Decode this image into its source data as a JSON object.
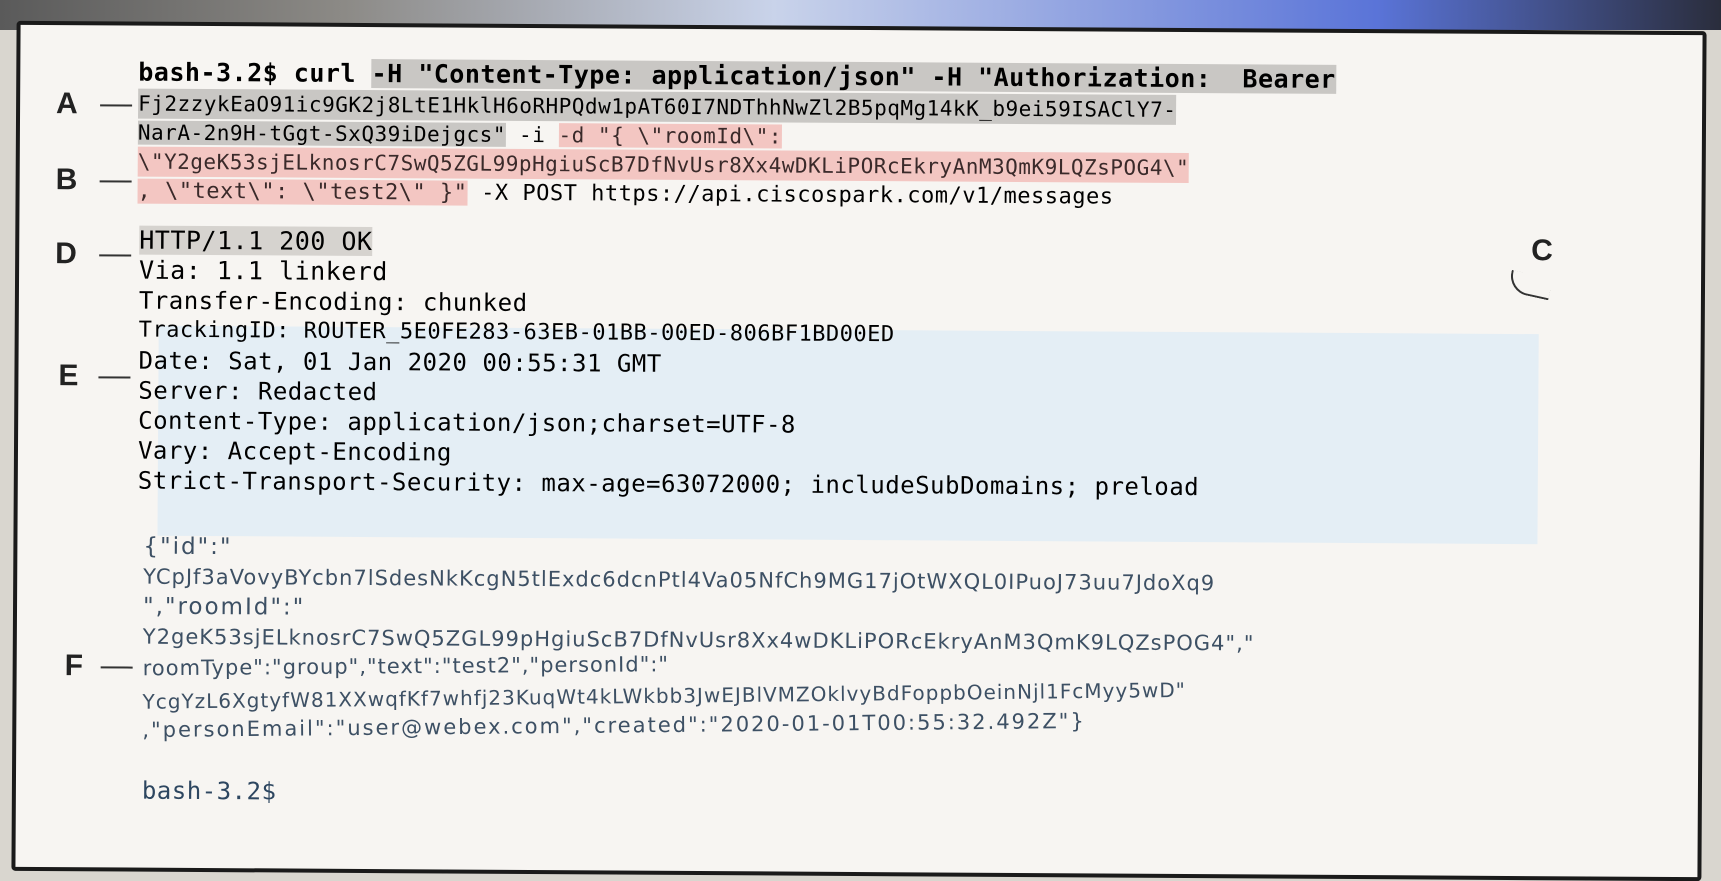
{
  "terminal": {
    "prompt": "bash-3.2$",
    "command": {
      "curl": "curl",
      "header_content_type": "-H \"Content-Type: application/json\" -H \"Authorization:  Bearer",
      "token_line1": "Fj2zzykEaO91ic9GK2j8LtE1HklH6oRHPQdw1pAT60I7NDThhNwZl2B5pqMg14kK_b9ei59ISAClY7-",
      "token_line2": "NarA-2n9H-tGgt-SxQ39iDejgcs\"",
      "flag_i": "-i",
      "data_flag": "-d \"{ \\\"roomId\\\":",
      "room_id_line": "\\\"Y2geK53sjELknosrC7SwQ5ZGL99pHgiuScB7DfNvUsr8Xx4wDKLiPORcEkryAnM3QmK9LQZsPOG4\\\"",
      "text_part": ", \\\"text\\\": \\\"test2\\\" }\"",
      "method_url": "-X POST https://api.ciscospark.com/v1/messages"
    },
    "response_headers": {
      "status": "HTTP/1.1 200 OK",
      "via": "Via: 1.1 linkerd",
      "transfer_encoding": "Transfer-Encoding: chunked",
      "tracking_id": "TrackingID: ROUTER_5E0FE283-63EB-01BB-00ED-806BF1BD00ED",
      "date": "Date: Sat, 01 Jan 2020 00:55:31 GMT",
      "server": "Server: Redacted",
      "content_type": "Content-Type: application/json;charset=UTF-8",
      "vary": "Vary: Accept-Encoding",
      "hsts": "Strict-Transport-Security: max-age=63072000; includeSubDomains; preload"
    },
    "response_body": [
      "{\"id\":\"",
      "YCpJf3aVovyBYcbn7lSdesNkKcgN5tlExdc6dcnPtl4Va05NfCh9MG17jOtWXQL0IPuoJ73uu7JdoXq9",
      "\",\"roomId\":\"",
      "Y2geK53sjELknosrC7SwQ5ZGL99pHgiuScB7DfNvUsr8Xx4wDKLiPORcEkryAnM3QmK9LQZsPOG4\",\"",
      "roomType\":\"group\",\"text\":\"test2\",\"personId\":\"",
      "YcgYzL6XgtyfW81XXwqfKf7whfj23KuqWt4kLWkbb3JwEJBlVMZOklvyBdFoppbOeinNjl1FcMyy5wD\"",
      ",\"personEmail\":\"user@webex.com\",\"created\":\"2020-01-01T00:55:32.492Z\"}"
    ],
    "final_prompt": "bash-3.2$"
  },
  "markers": {
    "a": "A",
    "b": "B",
    "c": "C",
    "d": "D",
    "e": "E",
    "f": "F"
  },
  "colors": {
    "gray_highlight": "#c9c7c4",
    "pink_highlight": "#f3c6c2",
    "blue_highlight": "#e4eef5"
  }
}
